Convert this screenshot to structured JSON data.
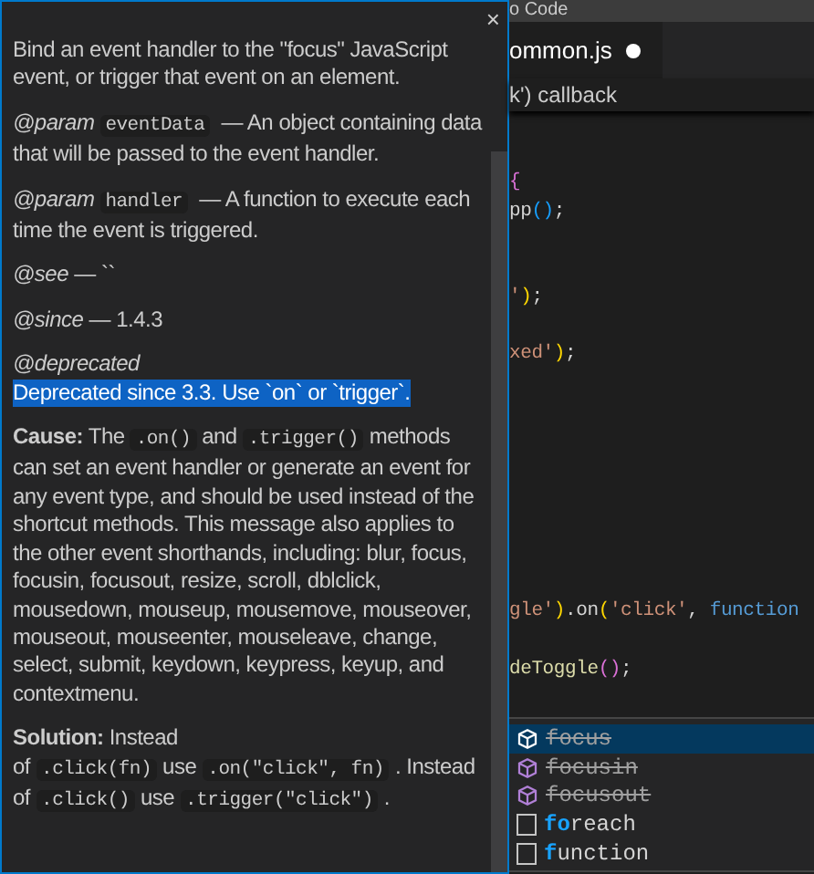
{
  "hover": {
    "close": "×",
    "paragraphs": [
      {
        "kind": "plain",
        "segments": [
          {
            "kind": "text",
            "text": "Bind an event handler to the \"focus\" JavaScript event, or trigger that event on an element."
          }
        ]
      },
      {
        "kind": "plain",
        "segments": [
          {
            "kind": "tag",
            "text": "@param"
          },
          {
            "kind": "code",
            "text": "eventData"
          },
          {
            "kind": "text",
            "text": " — An object containing data that will be passed to the event handler."
          }
        ]
      },
      {
        "kind": "plain",
        "segments": [
          {
            "kind": "tag",
            "text": "@param"
          },
          {
            "kind": "code",
            "text": "handler"
          },
          {
            "kind": "text",
            "text": " — A function to execute each time the event is triggered."
          }
        ]
      },
      {
        "kind": "plain",
        "segments": [
          {
            "kind": "tag",
            "text": "@see"
          },
          {
            "kind": "text",
            "text": " — ``"
          }
        ]
      },
      {
        "kind": "plain",
        "segments": [
          {
            "kind": "tag",
            "text": "@since"
          },
          {
            "kind": "text",
            "text": " — 1.4.3"
          }
        ]
      },
      {
        "kind": "plain",
        "segments": [
          {
            "kind": "tag",
            "text": "@deprecated"
          }
        ]
      },
      {
        "kind": "highlighted",
        "segments": [
          {
            "kind": "text",
            "text": "Deprecated since 3.3. Use `on` or `trigger`."
          }
        ]
      },
      {
        "kind": "plain",
        "segments": [
          {
            "kind": "bold",
            "text": "Cause:"
          },
          {
            "kind": "text",
            "text": " The"
          },
          {
            "kind": "code",
            "text": ".on()"
          },
          {
            "kind": "text",
            "text": "and"
          },
          {
            "kind": "code",
            "text": ".trigger()"
          },
          {
            "kind": "text",
            "text": "methods can set an event handler or generate an event for any event type, and should be used instead of the shortcut methods. This message also applies to the other event shorthands, including: blur, focus, focusin, focusout, resize, scroll, dblclick, mousedown, mouseup, mousemove, mouseover, mouseout, mouseenter, mouseleave, change, select, submit, keydown, keypress, keyup, and contextmenu."
          }
        ]
      },
      {
        "kind": "plain",
        "segments": [
          {
            "kind": "bold",
            "text": "Solution:"
          },
          {
            "kind": "text",
            "text": " Instead of"
          },
          {
            "kind": "code",
            "text": ".click(fn)"
          },
          {
            "kind": "text",
            "text": "use"
          },
          {
            "kind": "code",
            "text": ".on(\"click\", fn)"
          },
          {
            "kind": "text",
            "text": ". Instead of"
          },
          {
            "kind": "code",
            "text": ".click()"
          },
          {
            "kind": "text",
            "text": "use"
          },
          {
            "kind": "code",
            "text": ".trigger(\"click\")"
          },
          {
            "kind": "text",
            "text": "."
          }
        ]
      }
    ]
  },
  "window": {
    "title": "o Code"
  },
  "tab": {
    "label": "ommon.js",
    "dirty": true
  },
  "breadcrumb": "k') callback",
  "code_lines": [
    {
      "kind": "code",
      "tokens": [
        {
          "kind": "bracket",
          "text": "{"
        }
      ]
    },
    {
      "kind": "code",
      "tokens": [
        {
          "kind": "plain",
          "text": "pp"
        },
        {
          "kind": "paren",
          "text": "()"
        },
        {
          "kind": "plain",
          "text": ";"
        }
      ]
    },
    {
      "kind": "blank"
    },
    {
      "kind": "blank"
    },
    {
      "kind": "code",
      "tokens": [
        {
          "kind": "string",
          "text": "'"
        },
        {
          "kind": "yparen",
          "text": ")"
        },
        {
          "kind": "plain",
          "text": ";"
        }
      ]
    },
    {
      "kind": "blank"
    },
    {
      "kind": "code",
      "tokens": [
        {
          "kind": "string",
          "text": "xed'"
        },
        {
          "kind": "yparen",
          "text": ")"
        },
        {
          "kind": "plain",
          "text": ";"
        }
      ]
    },
    {
      "kind": "blank"
    },
    {
      "kind": "blank"
    },
    {
      "kind": "blank"
    },
    {
      "kind": "blank"
    },
    {
      "kind": "blank"
    },
    {
      "kind": "blank"
    },
    {
      "kind": "blank"
    },
    {
      "kind": "blank"
    },
    {
      "kind": "code",
      "tokens": [
        {
          "kind": "string",
          "text": "gle'"
        },
        {
          "kind": "yparen",
          "text": ")"
        },
        {
          "kind": "plain",
          "text": ".on"
        },
        {
          "kind": "yparen",
          "text": "("
        },
        {
          "kind": "string",
          "text": "'click'"
        },
        {
          "kind": "plain",
          "text": ", "
        },
        {
          "kind": "keyword",
          "text": "function"
        }
      ]
    },
    {
      "kind": "blank"
    },
    {
      "kind": "code",
      "tokens": [
        {
          "kind": "fn",
          "text": "deToggle"
        },
        {
          "kind": "bracket",
          "text": "()"
        },
        {
          "kind": "plain",
          "text": ";"
        }
      ]
    }
  ],
  "suggestions": [
    {
      "kind": "method",
      "matched": "fo",
      "rest": "cus",
      "deprecated": true,
      "selected": true
    },
    {
      "kind": "method",
      "matched": "fo",
      "rest": "cusin",
      "deprecated": true,
      "selected": false
    },
    {
      "kind": "method",
      "matched": "fo",
      "rest": "cusout",
      "deprecated": true,
      "selected": false
    },
    {
      "kind": "snippet",
      "matched": "fo",
      "rest": "reach",
      "deprecated": false,
      "selected": false
    },
    {
      "kind": "snippet",
      "matched": "f",
      "rest": "unction",
      "deprecated": false,
      "selected": false
    }
  ]
}
